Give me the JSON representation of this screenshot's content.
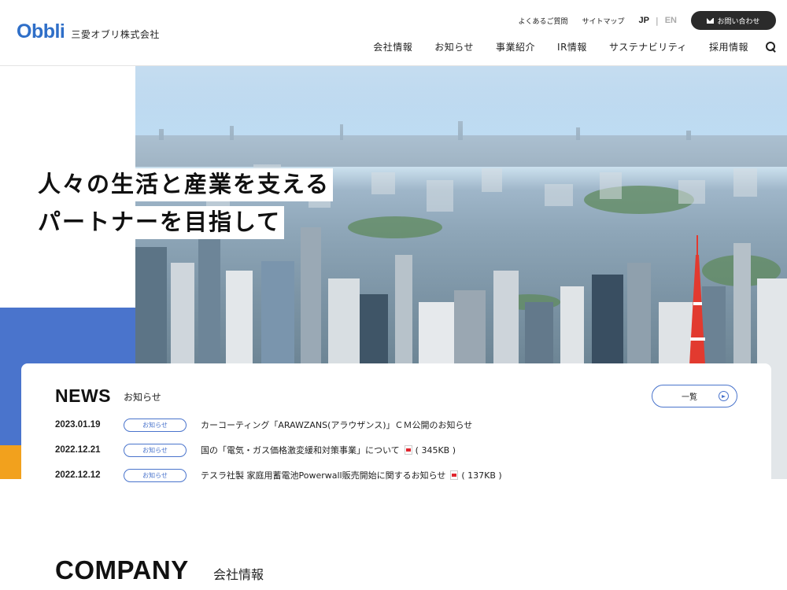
{
  "header": {
    "logo": {
      "mark": "Obbli",
      "company": "三愛オブリ株式会社"
    },
    "utility": {
      "faq": "よくあるご質問",
      "sitemap": "サイトマップ",
      "lang_jp": "JP",
      "lang_sep": "|",
      "lang_en": "EN",
      "contact": "お問い合わせ"
    },
    "nav": [
      "会社情報",
      "お知らせ",
      "事業紹介",
      "IR情報",
      "サステナビリティ",
      "採用情報"
    ],
    "search_icon": "search-icon"
  },
  "hero": {
    "catch_line1": "人々の生活と産業を支える",
    "catch_line2": "パートナーを目指して",
    "colors": {
      "accent_blue": "#4a74cc",
      "accent_orange": "#f2a11d"
    }
  },
  "news": {
    "title": "NEWS",
    "subtitle": "お知らせ",
    "more": "一覧",
    "items": [
      {
        "date": "2023.01.19",
        "category": "お知らせ",
        "text": "カーコーティング「ARAWZANS(アラウザンス)」ＣＭ公開のお知らせ",
        "size": ""
      },
      {
        "date": "2022.12.21",
        "category": "お知らせ",
        "text": "国の「電気・ガス価格激変緩和対策事業」について",
        "size": "( 345KB )"
      },
      {
        "date": "2022.12.12",
        "category": "お知らせ",
        "text": "テスラ社製 家庭用蓄電池Powerwall販売開始に関するお知らせ",
        "size": "( 137KB )"
      }
    ]
  },
  "company": {
    "title": "COMPANY",
    "subtitle": "会社情報"
  }
}
